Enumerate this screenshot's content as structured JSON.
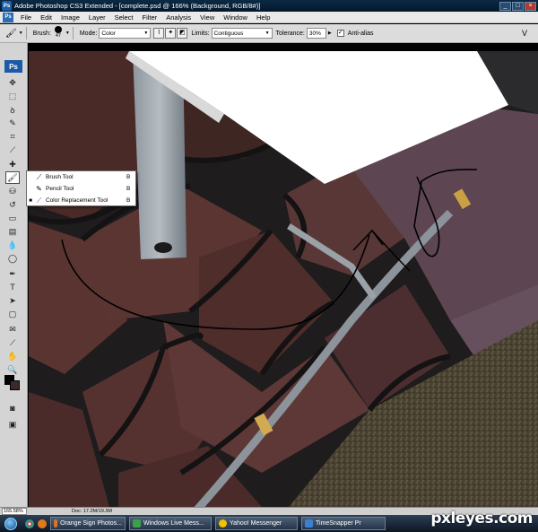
{
  "window": {
    "title": "Adobe Photoshop CS3 Extended - [complete.psd @ 166% (Background, RGB/8#)]"
  },
  "menubar": {
    "items": [
      "File",
      "Edit",
      "Image",
      "Layer",
      "Select",
      "Filter",
      "Analysis",
      "View",
      "Window",
      "Help"
    ]
  },
  "options": {
    "brush_label": "Brush:",
    "brush_size": "47",
    "mode_label": "Mode:",
    "mode_value": "Color",
    "limits_label": "Limits:",
    "limits_value": "Contiguous",
    "tolerance_label": "Tolerance:",
    "tolerance_value": "30%",
    "antialias_label": "Anti-alias",
    "antialias_checked": true
  },
  "toolbox": {
    "logo": "Ps"
  },
  "flyout": {
    "items": [
      {
        "label": "Brush Tool",
        "key": "B",
        "selected": false
      },
      {
        "label": "Pencil Tool",
        "key": "B",
        "selected": false
      },
      {
        "label": "Color Replacement Tool",
        "key": "B",
        "selected": true
      }
    ]
  },
  "status": {
    "zoom": "165.58%",
    "doc": "Doc: 17.2M/19.3M"
  },
  "taskbar": {
    "tasks": [
      {
        "label": "Orange Sign Photos...",
        "icon_color": "#d9722a"
      },
      {
        "label": "Windows Live Mess...",
        "icon_color": "#3aa04a"
      },
      {
        "label": "Yahoo! Messenger",
        "icon_color": "#f2c200"
      },
      {
        "label": "TimeSnapper Pr",
        "icon_color": "#3c7fd0"
      }
    ]
  },
  "watermark": "pxleyes.com",
  "colors": {
    "foreground": "#000000",
    "background": "#3c2a2a",
    "accent": "#1c5aa6"
  }
}
